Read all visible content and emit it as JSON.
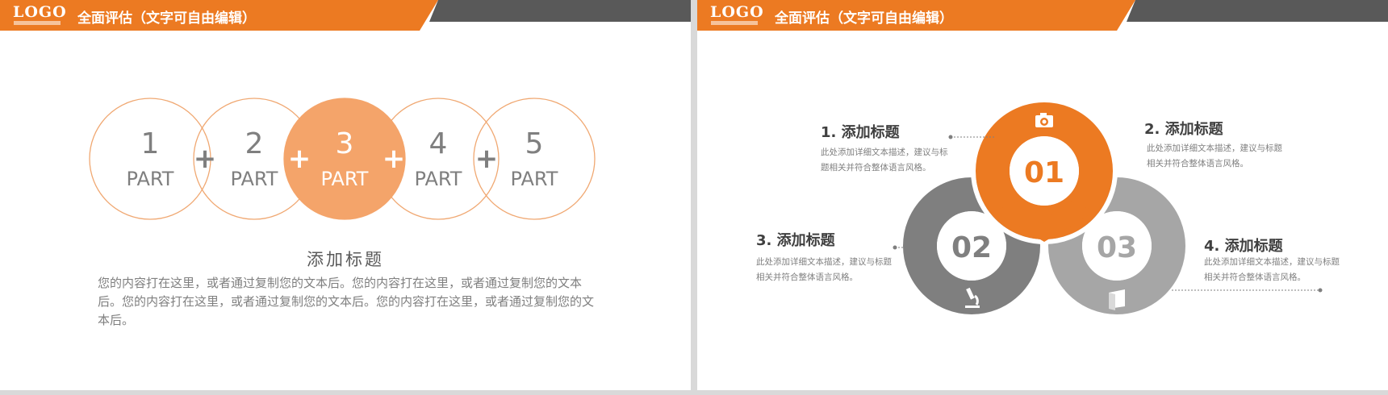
{
  "colors": {
    "orange": "#ec7a22",
    "orange_light": "#f4a46a",
    "dark_gray": "#7f7f7f",
    "mid_gray": "#a6a6a6",
    "header_gray": "#595959"
  },
  "slide1": {
    "logo": "LOGO",
    "header_title": "全面评估（文字可自由编辑）",
    "parts": [
      {
        "number": "1",
        "label": "PART"
      },
      {
        "number": "2",
        "label": "PART"
      },
      {
        "number": "3",
        "label": "PART"
      },
      {
        "number": "4",
        "label": "PART"
      },
      {
        "number": "5",
        "label": "PART"
      }
    ],
    "plus_symbol": "+",
    "highlighted_part": 3,
    "body_title": "添加标题",
    "body_text": "您的内容打在这里，或者通过复制您的文本后。您的内容打在这里，或者通过复制您的文本后。您的内容打在这里，或者通过复制您的文本后。您的内容打在这里，或者通过复制您的文本后。"
  },
  "slide2": {
    "logo": "LOGO",
    "header_title": "全面评估（文字可自由编辑）",
    "rings": [
      {
        "number": "01",
        "icon": "camera-icon"
      },
      {
        "number": "02",
        "icon": "microscope-icon"
      },
      {
        "number": "03",
        "icon": "book-icon"
      }
    ],
    "items": [
      {
        "title": "1. 添加标题",
        "desc": "此处添加详细文本描述，建议与标题相关并符合整体语言风格。"
      },
      {
        "title": "2. 添加标题",
        "desc": "此处添加详细文本描述，建议与标题相关并符合整体语言风格。"
      },
      {
        "title": "3. 添加标题",
        "desc": "此处添加详细文本描述，建议与标题相关并符合整体语言风格。"
      },
      {
        "title": "4. 添加标题",
        "desc": "此处添加详细文本描述，建议与标题相关并符合整体语言风格。"
      }
    ]
  }
}
